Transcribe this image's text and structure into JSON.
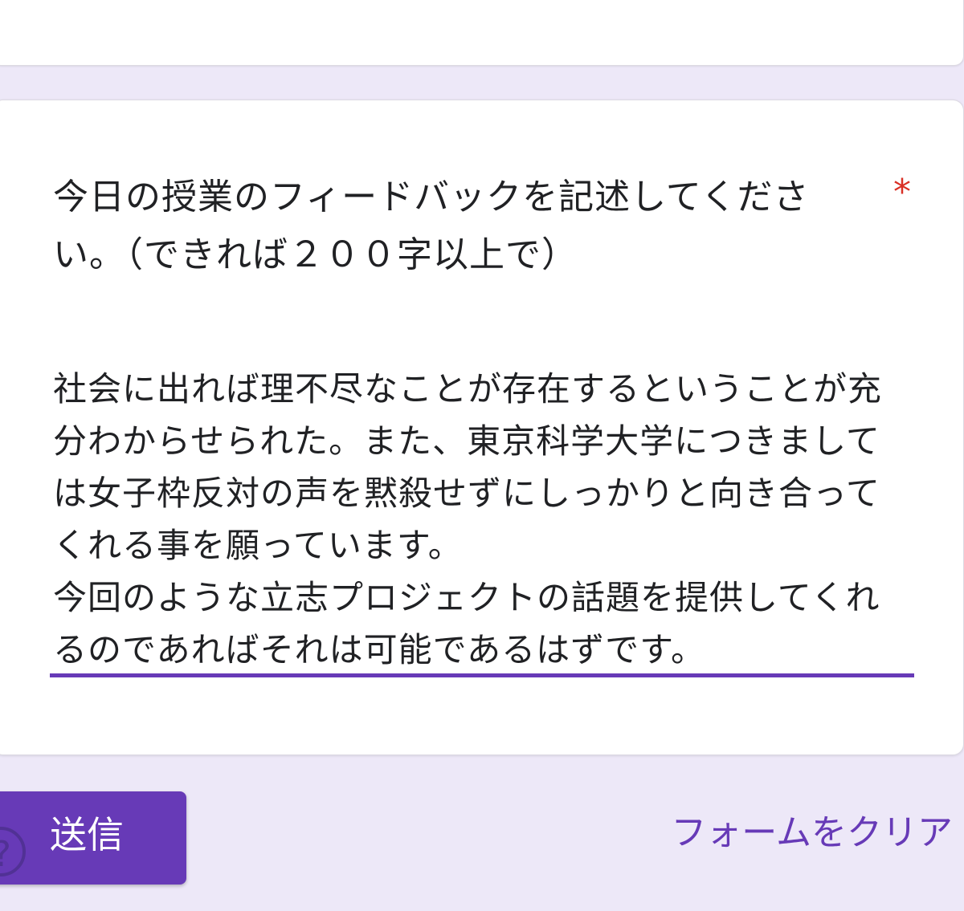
{
  "question": {
    "title": "今日の授業のフィードバックを記述してください。（できれば２００字以上で）",
    "required_marker": "*"
  },
  "answer": {
    "value": "社会に出れば理不尽なことが存在するということが充分わからせられた。また、東京科学大学につきましては女子枠反対の声を黙殺せずにしっかりと向き合ってくれる事を願っています。\n今回のような立志プロジェクトの話題を提供してくれるのであればそれは可能であるはずです。"
  },
  "footer": {
    "submit_label": "送信",
    "clear_label": "フォームをクリア"
  },
  "icons": {
    "help": "help-circle-icon"
  },
  "colors": {
    "accent": "#673ab7",
    "background": "#ede8f8",
    "required": "#d93025"
  }
}
